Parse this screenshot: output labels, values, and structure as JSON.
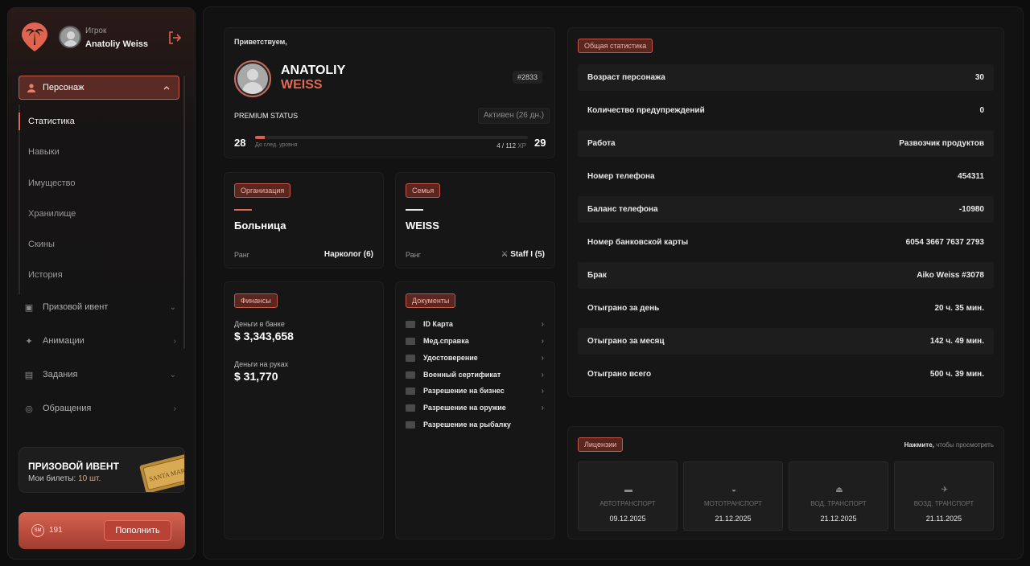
{
  "user": {
    "role": "Игрок",
    "name": "Anatoliy Weiss"
  },
  "nav": {
    "active": "Персонаж",
    "sub": [
      "Статистика",
      "Навыки",
      "Имущество",
      "Хранилище",
      "Скины",
      "История"
    ],
    "items": [
      {
        "label": "Призовой ивент",
        "icon": "ticket-icon"
      },
      {
        "label": "Анимации",
        "icon": "animation-icon"
      },
      {
        "label": "Задания",
        "icon": "clipboard-icon"
      },
      {
        "label": "Обращения",
        "icon": "support-icon"
      }
    ]
  },
  "event": {
    "title": "ПРИЗОВОЙ ИВЕНТ",
    "tickets_label": "Мои билеты:",
    "tickets_value": "10 шт.",
    "ticket_text": "SANTA MARIA"
  },
  "balance": {
    "coin_label": "SM",
    "value": "191",
    "button": "Пополнить"
  },
  "profile": {
    "greeting": "Приветствуем,",
    "first_name": "ANATOLIY",
    "last_name": "WEISS",
    "id": "#2833",
    "premium": "PREMIUM STATUS",
    "premium_state": "Активен (26 дн.)",
    "level_current": "28",
    "level_next": "29",
    "xp_note": "До след. уровня",
    "xp_current": "4",
    "xp_total": "112",
    "xp_unit": "XP",
    "xp_fraction": 0.036
  },
  "organization": {
    "tag": "Организация",
    "name": "Больница",
    "rank_label": "Ранг",
    "rank_value": "Нарколог (6)"
  },
  "family": {
    "tag": "Семья",
    "name": "WEISS",
    "rank_label": "Ранг",
    "rank_value": "Staff I (5)"
  },
  "finance": {
    "tag": "Финансы",
    "bank_label": "Деньги в банке",
    "bank_value": "$ 3,343,658",
    "cash_label": "Деньги на руках",
    "cash_value": "$ 31,770"
  },
  "documents": {
    "tag": "Документы",
    "items": [
      "ID Карта",
      "Мед.справка",
      "Удостоверение",
      "Военный сертификат",
      "Разрешение на бизнес",
      "Разрешение на оружие",
      "Разрешение на рыбалку"
    ]
  },
  "stats": {
    "tag": "Общая статистика",
    "rows": [
      {
        "k": "Возраст персонажа",
        "v": "30"
      },
      {
        "k": "Количество предупреждений",
        "v": "0"
      },
      {
        "k": "Работа",
        "v": "Развозчик продуктов"
      },
      {
        "k": "Номер телефона",
        "v": "454311"
      },
      {
        "k": "Баланс телефона",
        "v": "-10980"
      },
      {
        "k": "Номер банковской карты",
        "v": "6054 3667 7637 2793"
      },
      {
        "k": "Брак",
        "v": "Aiko Weiss #3078"
      },
      {
        "k": "Отыграно за день",
        "v": "20 ч. 35 мин."
      },
      {
        "k": "Отыграно за месяц",
        "v": "142 ч. 49 мин."
      },
      {
        "k": "Отыграно всего",
        "v": "500 ч. 39 мин."
      }
    ]
  },
  "licenses": {
    "tag": "Лицензии",
    "note_bold": "Нажмите,",
    "note_rest": " чтобы просмотреть",
    "items": [
      {
        "name": "АВТОТРАНСПОРТ",
        "date": "09.12.2025",
        "icon": "car-icon"
      },
      {
        "name": "МОТОТРАНСПОРТ",
        "date": "21.12.2025",
        "icon": "motorcycle-icon"
      },
      {
        "name": "ВОД. ТРАНСПОРТ",
        "date": "21.12.2025",
        "icon": "boat-icon"
      },
      {
        "name": "ВОЗД. ТРАНСПОРТ",
        "date": "21.11.2025",
        "icon": "helicopter-icon"
      }
    ]
  },
  "colors": {
    "accent": "#e36852",
    "tag_bg": "#5a2620",
    "panel": "#161616"
  }
}
